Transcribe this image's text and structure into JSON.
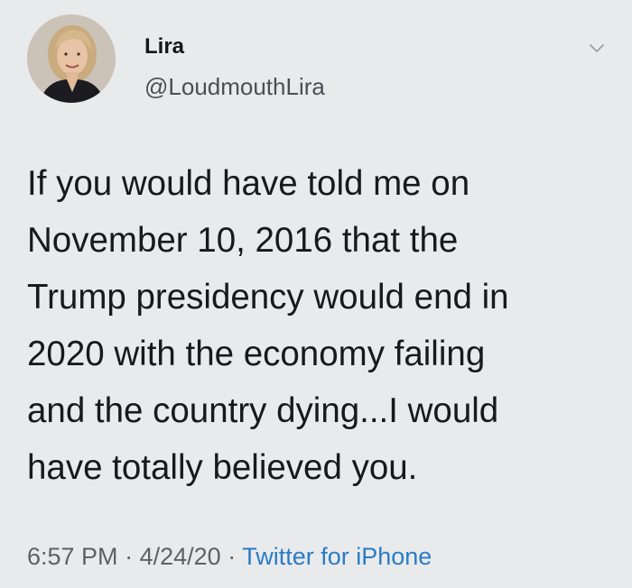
{
  "author": {
    "display_name": "Lira",
    "handle": "@LoudmouthLira"
  },
  "tweet": {
    "lines": [
      "If you would have told me on",
      "November 10, 2016 that the",
      "Trump presidency would end in",
      "2020 with the economy failing",
      "and the country dying...I would",
      "have totally believed you."
    ],
    "time": "6:57 PM",
    "date": "4/24/20",
    "separator": "·",
    "source": "Twitter for iPhone"
  },
  "icons": {
    "menu": "chevron-down-icon",
    "avatar": "profile-photo"
  },
  "colors": {
    "background": "#e9eaec",
    "text": "#17191c",
    "meta": "#5d6166",
    "link": "#2a7cc4"
  }
}
